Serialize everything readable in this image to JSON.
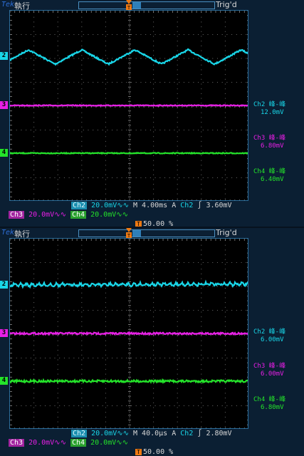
{
  "colors": {
    "ch2": "#19d6e8",
    "ch3": "#e81fe6",
    "ch4": "#24e32a",
    "trigger": "#f07a12",
    "background": "#0b1f33",
    "grid": "#555555"
  },
  "panels": [
    {
      "header": {
        "brand": "Tek",
        "run_state": "執行",
        "trig_state": "Trig'd",
        "record_position": 0.42
      },
      "channel_markers": {
        "ch2": "2",
        "ch3": "3",
        "ch4": "4"
      },
      "trigger_marker": "T",
      "measurements": [
        {
          "label": "Ch2 峰-峰",
          "value": "12.0mV"
        },
        {
          "label": "Ch3 峰-峰",
          "value": "6.80mV"
        },
        {
          "label": "Ch4 峰-峰",
          "value": "6.40mV"
        }
      ],
      "status": {
        "ch2": "Ch2",
        "ch2_scale": "20.0mV",
        "ch2_suffix": "∿∿",
        "timebase": "M 4.00ms",
        "trig_mode": "A",
        "trig_source": "Ch2",
        "trig_slope": "∫",
        "trig_level": "3.60mV",
        "ch3": "Ch3",
        "ch3_scale": "20.0mV",
        "ch3_suffix": "∿∿",
        "ch4": "Ch4",
        "ch4_scale": "20.0mV",
        "ch4_suffix": "∿∿",
        "trig_pos_icon": "T",
        "trig_pos": "50.00 %"
      },
      "wave": {
        "type": "triangle",
        "cycles": 4.5,
        "ripple_divisions": 0.6
      }
    },
    {
      "header": {
        "brand": "Tek",
        "run_state": "執行",
        "trig_state": "Trig'd",
        "record_position": 0.42
      },
      "channel_markers": {
        "ch2": "2",
        "ch3": "3",
        "ch4": "4"
      },
      "trigger_marker": "T",
      "measurements": [
        {
          "label": "Ch2 峰-峰",
          "value": "6.00mV"
        },
        {
          "label": "Ch3 峰-峰",
          "value": "6.00mV"
        },
        {
          "label": "Ch4 峰-峰",
          "value": "6.80mV"
        }
      ],
      "status": {
        "ch2": "Ch2",
        "ch2_scale": "20.0mV",
        "ch2_suffix": "∿∿",
        "timebase": "M 40.0µs",
        "trig_mode": "A",
        "trig_source": "Ch2",
        "trig_slope": "∫",
        "trig_level": "2.80mV",
        "ch3": "Ch3",
        "ch3_scale": "20.0mV",
        "ch3_suffix": "∿∿",
        "ch4": "Ch4",
        "ch4_scale": "20.0mV",
        "ch4_suffix": "∿∿",
        "trig_pos_icon": "T",
        "trig_pos": "50.00 %"
      },
      "wave": {
        "type": "noise",
        "cycles": 40,
        "ripple_divisions": 0.3
      }
    }
  ]
}
